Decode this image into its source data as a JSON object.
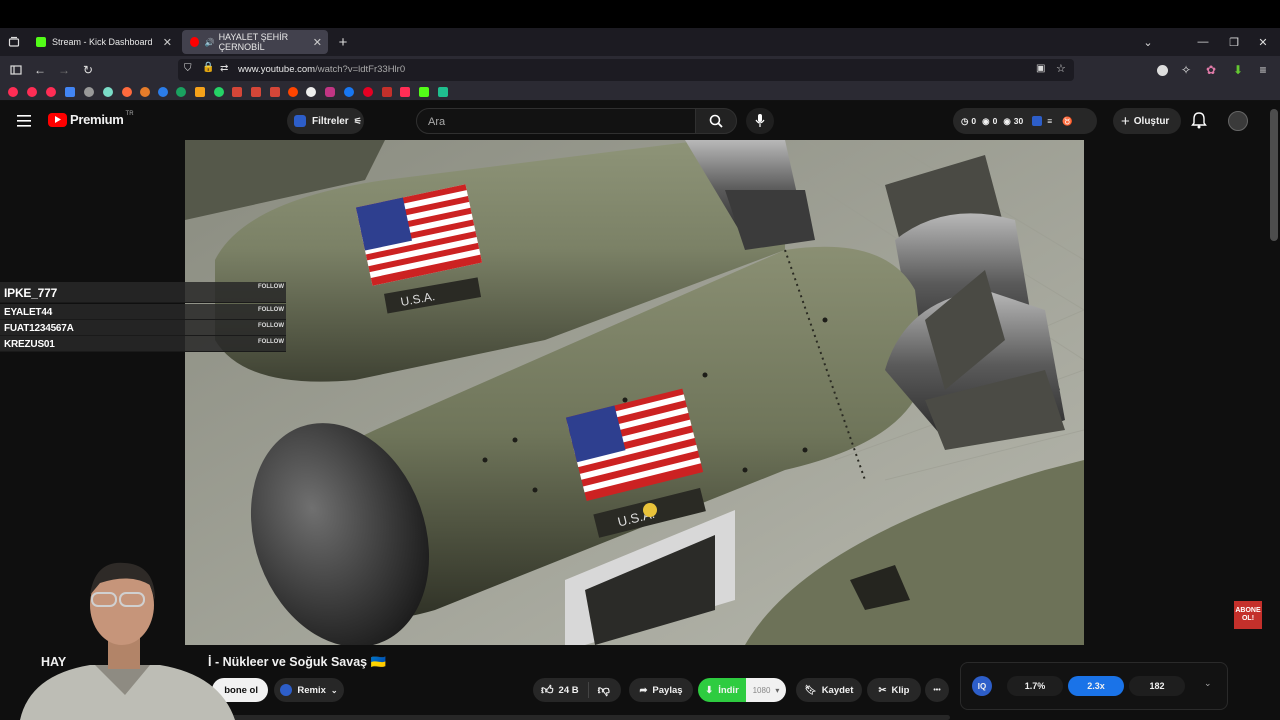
{
  "browser": {
    "tabs": [
      {
        "label": "Stream - Kick Dashboard",
        "active": false,
        "favicon_color": "#53fc18"
      },
      {
        "label": "HAYALET ŞEHİR ÇERNOBİL",
        "active": true,
        "favicon_color": "#ff0000"
      }
    ],
    "new_tab_glyph": "+",
    "url_host": "www.youtube.com",
    "url_path": "/watch?v=ldtFr33Hlr0",
    "window_controls": [
      "⌄",
      "—",
      "❐",
      "✕"
    ]
  },
  "youtube": {
    "logo_text": "Premium",
    "logo_suffix": "TR",
    "filters_label": "Filtreler",
    "search_placeholder": "Ara",
    "stats": [
      "0",
      "0",
      "30"
    ],
    "create_label": "Oluştur",
    "accent": "#ff0000"
  },
  "video": {
    "flag_text": "U.S.A."
  },
  "chat": [
    {
      "name": "IPKE_777",
      "follow": "FOLLOW"
    },
    {
      "name": "EYALET44",
      "follow": "FOLLOW"
    },
    {
      "name": "FUAT1234567A",
      "follow": "FOLLOW"
    },
    {
      "name": "KREZUS01",
      "follow": "FOLLOW"
    }
  ],
  "subscribe_badge": [
    "ABONE",
    "OL!"
  ],
  "below_video": {
    "title_prefix": "HAY",
    "title_visible": "İ - Nükleer ve Soğuk Savaş 🇺🇦",
    "subscribe_partial": "bone ol",
    "remix_label": "Remix",
    "like_count": "24 B",
    "share_label": "Paylaş",
    "download_label": "İndir",
    "quality": "1080",
    "save_label": "Kaydet",
    "clip_label": "Klip",
    "more_glyph": "•••"
  },
  "metrics": {
    "badge": "IQ",
    "values": [
      "1.7%",
      "2.3x",
      "182"
    ],
    "highlight_color": "#1a73e8"
  }
}
